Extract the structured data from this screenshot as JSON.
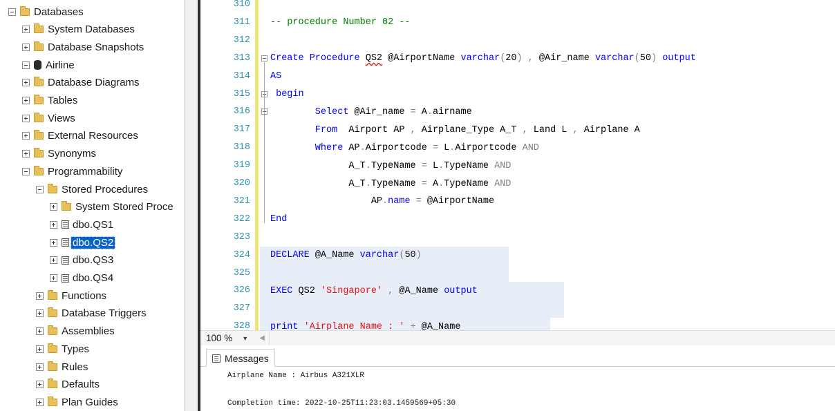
{
  "explorer": {
    "items": [
      {
        "label": "Databases",
        "icon": "folder-icon",
        "expander": "expanded",
        "depth": 0,
        "selected": false
      },
      {
        "label": "System Databases",
        "icon": "folder-icon",
        "expander": "collapsed",
        "depth": 1,
        "selected": false
      },
      {
        "label": "Database Snapshots",
        "icon": "folder-icon",
        "expander": "collapsed",
        "depth": 1,
        "selected": false
      },
      {
        "label": "Airline",
        "icon": "database-icon",
        "expander": "expanded",
        "depth": 1,
        "selected": false
      },
      {
        "label": "Database Diagrams",
        "icon": "folder-icon",
        "expander": "collapsed",
        "depth": 2,
        "selected": false
      },
      {
        "label": "Tables",
        "icon": "folder-icon",
        "expander": "collapsed",
        "depth": 2,
        "selected": false
      },
      {
        "label": "Views",
        "icon": "folder-icon",
        "expander": "collapsed",
        "depth": 2,
        "selected": false
      },
      {
        "label": "External Resources",
        "icon": "folder-icon",
        "expander": "collapsed",
        "depth": 2,
        "selected": false
      },
      {
        "label": "Synonyms",
        "icon": "folder-icon",
        "expander": "collapsed",
        "depth": 2,
        "selected": false
      },
      {
        "label": "Programmability",
        "icon": "folder-icon",
        "expander": "expanded",
        "depth": 2,
        "selected": false
      },
      {
        "label": "Stored Procedures",
        "icon": "folder-icon",
        "expander": "expanded",
        "depth": 3,
        "selected": false
      },
      {
        "label": "System Stored Proce",
        "icon": "folder-icon",
        "expander": "collapsed",
        "depth": 4,
        "selected": false
      },
      {
        "label": "dbo.QS1",
        "icon": "stored-procedure-icon",
        "expander": "collapsed",
        "depth": 4,
        "selected": false
      },
      {
        "label": "dbo.QS2",
        "icon": "stored-procedure-icon",
        "expander": "collapsed",
        "depth": 4,
        "selected": true
      },
      {
        "label": "dbo.QS3",
        "icon": "stored-procedure-icon",
        "expander": "collapsed",
        "depth": 4,
        "selected": false
      },
      {
        "label": "dbo.QS4",
        "icon": "stored-procedure-icon",
        "expander": "collapsed",
        "depth": 4,
        "selected": false
      },
      {
        "label": "Functions",
        "icon": "folder-icon",
        "expander": "collapsed",
        "depth": 3,
        "selected": false
      },
      {
        "label": "Database Triggers",
        "icon": "folder-icon",
        "expander": "collapsed",
        "depth": 3,
        "selected": false
      },
      {
        "label": "Assemblies",
        "icon": "folder-icon",
        "expander": "collapsed",
        "depth": 3,
        "selected": false
      },
      {
        "label": "Types",
        "icon": "folder-icon",
        "expander": "collapsed",
        "depth": 3,
        "selected": false
      },
      {
        "label": "Rules",
        "icon": "folder-icon",
        "expander": "collapsed",
        "depth": 3,
        "selected": false
      },
      {
        "label": "Defaults",
        "icon": "folder-icon",
        "expander": "collapsed",
        "depth": 3,
        "selected": false
      },
      {
        "label": "Plan Guides",
        "icon": "folder-icon",
        "expander": "collapsed",
        "depth": 3,
        "selected": false
      }
    ]
  },
  "editor": {
    "colors": {
      "keyword": "#0000ff",
      "string": "#e31515",
      "operator": "#808080",
      "comment": "#008000",
      "line_number": "#2b91af",
      "change_margin": "#f2e27a"
    },
    "lines": [
      {
        "num": "310",
        "segments": []
      },
      {
        "num": "311",
        "segments": [
          {
            "t": "-- procedure Number 02 --",
            "c": "cmt"
          }
        ]
      },
      {
        "num": "312",
        "segments": []
      },
      {
        "num": "313",
        "segments": [
          {
            "t": "Create Procedure ",
            "c": "kw"
          },
          {
            "t": "QS2",
            "c": "plain squiggle"
          },
          {
            "t": " @AirportName ",
            "c": "plain"
          },
          {
            "t": "varchar",
            "c": "kw"
          },
          {
            "t": "(",
            "c": "gray"
          },
          {
            "t": "20",
            "c": "plain"
          },
          {
            "t": ")",
            "c": "gray"
          },
          {
            "t": " ",
            "c": "plain"
          },
          {
            "t": ",",
            "c": "gray"
          },
          {
            "t": " @Air_name ",
            "c": "plain"
          },
          {
            "t": "varchar",
            "c": "kw"
          },
          {
            "t": "(",
            "c": "gray"
          },
          {
            "t": "50",
            "c": "plain"
          },
          {
            "t": ")",
            "c": "gray"
          },
          {
            "t": " output",
            "c": "kw"
          }
        ]
      },
      {
        "num": "314",
        "segments": [
          {
            "t": "AS",
            "c": "kw"
          }
        ]
      },
      {
        "num": "315",
        "segments": [
          {
            "t": " begin",
            "c": "kw"
          }
        ]
      },
      {
        "num": "316",
        "segments": [
          {
            "t": "        Select ",
            "c": "kw"
          },
          {
            "t": "@Air_name ",
            "c": "plain"
          },
          {
            "t": "=",
            "c": "gray"
          },
          {
            "t": " A",
            "c": "plain"
          },
          {
            "t": ".",
            "c": "gray"
          },
          {
            "t": "airname",
            "c": "plain"
          }
        ]
      },
      {
        "num": "317",
        "segments": [
          {
            "t": "        From  ",
            "c": "kw"
          },
          {
            "t": "Airport AP ",
            "c": "plain"
          },
          {
            "t": ",",
            "c": "gray"
          },
          {
            "t": " Airplane_Type A_T ",
            "c": "plain"
          },
          {
            "t": ",",
            "c": "gray"
          },
          {
            "t": " Land L ",
            "c": "plain"
          },
          {
            "t": ",",
            "c": "gray"
          },
          {
            "t": " Airplane A",
            "c": "plain"
          }
        ]
      },
      {
        "num": "318",
        "segments": [
          {
            "t": "        Where ",
            "c": "kw"
          },
          {
            "t": "AP",
            "c": "plain"
          },
          {
            "t": ".",
            "c": "gray"
          },
          {
            "t": "Airportcode ",
            "c": "plain"
          },
          {
            "t": "=",
            "c": "gray"
          },
          {
            "t": " L",
            "c": "plain"
          },
          {
            "t": ".",
            "c": "gray"
          },
          {
            "t": "Airportcode ",
            "c": "plain"
          },
          {
            "t": "AND",
            "c": "gray"
          }
        ]
      },
      {
        "num": "319",
        "segments": [
          {
            "t": "              A_T",
            "c": "plain"
          },
          {
            "t": ".",
            "c": "gray"
          },
          {
            "t": "TypeName ",
            "c": "plain"
          },
          {
            "t": "=",
            "c": "gray"
          },
          {
            "t": " L",
            "c": "plain"
          },
          {
            "t": ".",
            "c": "gray"
          },
          {
            "t": "TypeName ",
            "c": "plain"
          },
          {
            "t": "AND",
            "c": "gray"
          }
        ]
      },
      {
        "num": "320",
        "segments": [
          {
            "t": "              A_T",
            "c": "plain"
          },
          {
            "t": ".",
            "c": "gray"
          },
          {
            "t": "TypeName ",
            "c": "plain"
          },
          {
            "t": "=",
            "c": "gray"
          },
          {
            "t": " A",
            "c": "plain"
          },
          {
            "t": ".",
            "c": "gray"
          },
          {
            "t": "TypeName ",
            "c": "plain"
          },
          {
            "t": "AND",
            "c": "gray"
          }
        ]
      },
      {
        "num": "321",
        "segments": [
          {
            "t": "                  AP",
            "c": "plain"
          },
          {
            "t": ".",
            "c": "gray"
          },
          {
            "t": "name",
            "c": "kw"
          },
          {
            "t": " ",
            "c": "plain"
          },
          {
            "t": "=",
            "c": "gray"
          },
          {
            "t": " @AirportName",
            "c": "plain"
          }
        ]
      },
      {
        "num": "322",
        "segments": [
          {
            "t": "End",
            "c": "kw"
          }
        ]
      },
      {
        "num": "323",
        "segments": []
      },
      {
        "num": "324",
        "segments": [
          {
            "t": "DECLARE ",
            "c": "kw"
          },
          {
            "t": "@A_Name ",
            "c": "plain"
          },
          {
            "t": "varchar",
            "c": "kw"
          },
          {
            "t": "(",
            "c": "gray"
          },
          {
            "t": "50",
            "c": "plain"
          },
          {
            "t": ")",
            "c": "gray"
          }
        ]
      },
      {
        "num": "325",
        "segments": []
      },
      {
        "num": "326",
        "segments": [
          {
            "t": "EXEC ",
            "c": "kw"
          },
          {
            "t": "QS2 ",
            "c": "plain"
          },
          {
            "t": "'Singapore'",
            "c": "str"
          },
          {
            "t": " ",
            "c": "plain"
          },
          {
            "t": ",",
            "c": "gray"
          },
          {
            "t": " @A_Name ",
            "c": "plain"
          },
          {
            "t": "output",
            "c": "kw"
          }
        ]
      },
      {
        "num": "327",
        "segments": []
      },
      {
        "num": "328",
        "segments": [
          {
            "t": "print ",
            "c": "kw"
          },
          {
            "t": "'Airplane Name : '",
            "c": "str"
          },
          {
            "t": " ",
            "c": "plain"
          },
          {
            "t": "+",
            "c": "gray"
          },
          {
            "t": " @A_Name",
            "c": "plain"
          }
        ]
      }
    ]
  },
  "zoom": {
    "value": "100 %"
  },
  "results": {
    "tab_label": "Messages",
    "messages": [
      "Airplane Name : Airbus A321XLR",
      "",
      "Completion time: 2022-10-25T11:23:03.1459569+05:30"
    ]
  }
}
